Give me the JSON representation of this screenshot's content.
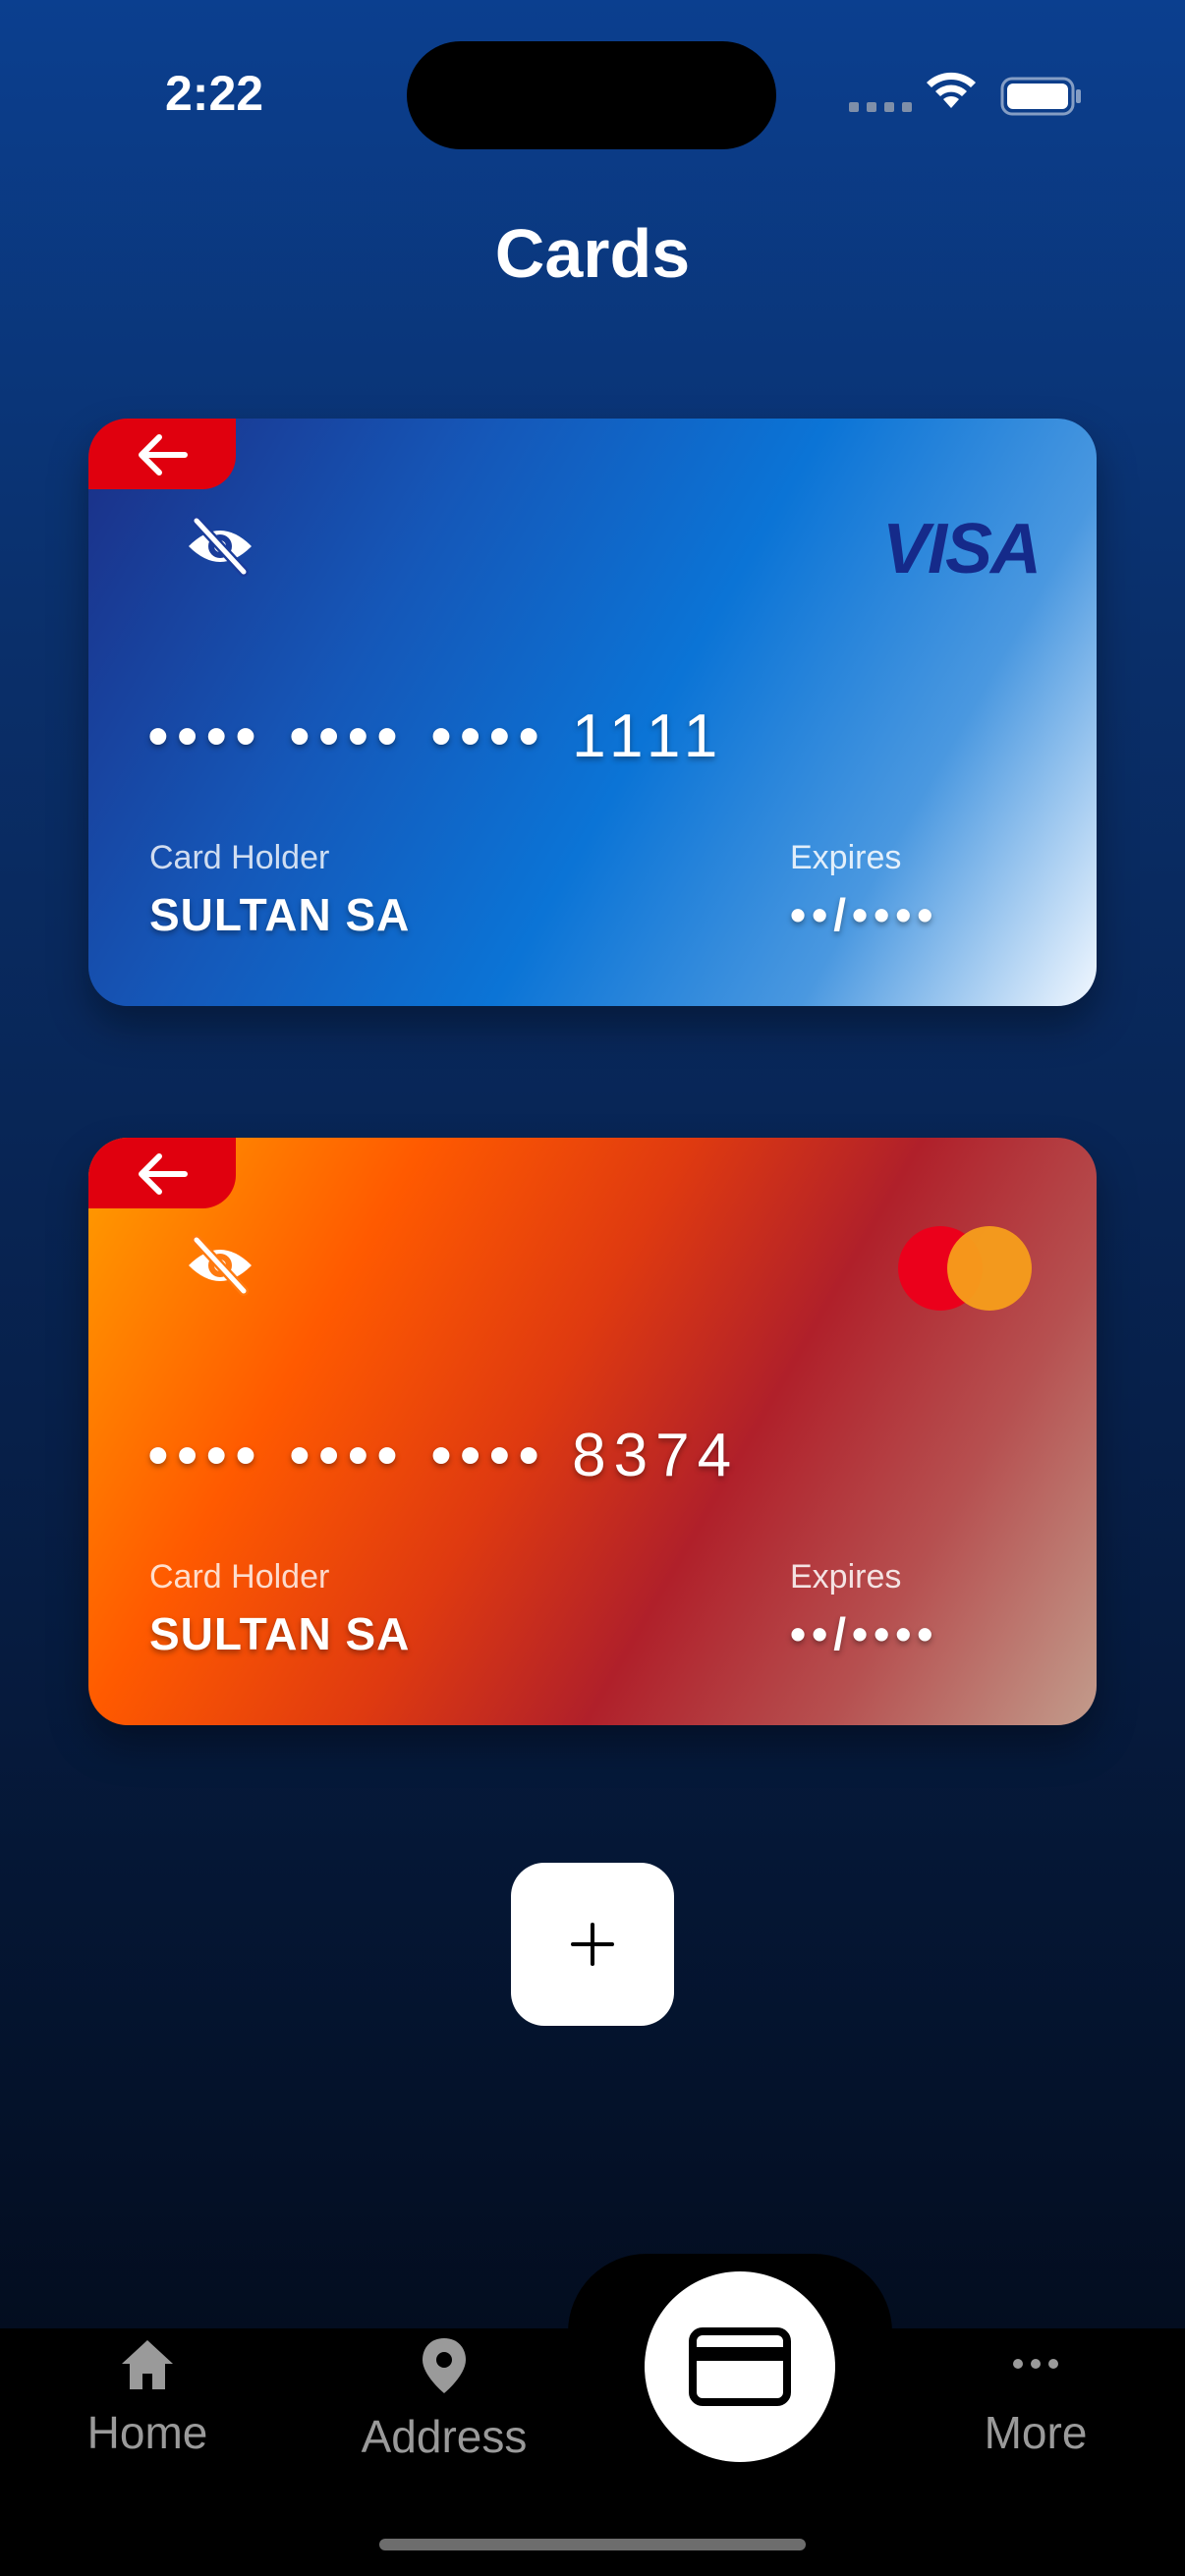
{
  "status_bar": {
    "time": "2:22"
  },
  "page": {
    "title": "Cards"
  },
  "cards": [
    {
      "brand": "VISA",
      "number_masked": "•••• •••• •••• 1111",
      "holder_label": "Card Holder",
      "holder_name": "SULTAN SA",
      "expires_label": "Expires",
      "expires_value": "••/••••",
      "colors": {
        "start": "#1b2f86",
        "mid": "#0b74d6",
        "end": "#f2f8ff"
      }
    },
    {
      "brand": "mastercard",
      "number_masked": "•••• •••• •••• 8374",
      "holder_label": "Card Holder",
      "holder_name": "SULTAN SA",
      "expires_label": "Expires",
      "expires_value": "••/••••",
      "colors": {
        "start": "#ff9e00",
        "mid": "#b0202a",
        "end": "#c29c8c"
      }
    }
  ],
  "add_button": {
    "icon": "plus-icon"
  },
  "tab_bar": {
    "items": [
      {
        "label": "Home",
        "icon": "home-icon"
      },
      {
        "label": "Address",
        "icon": "location-pin-icon"
      },
      {
        "label": "",
        "icon": "credit-card-icon",
        "active": true
      },
      {
        "label": "More",
        "icon": "more-dots-icon"
      }
    ]
  },
  "colors": {
    "accent_red": "#e0000e",
    "background_top": "#0b3f8f",
    "background_bottom": "#020814"
  }
}
